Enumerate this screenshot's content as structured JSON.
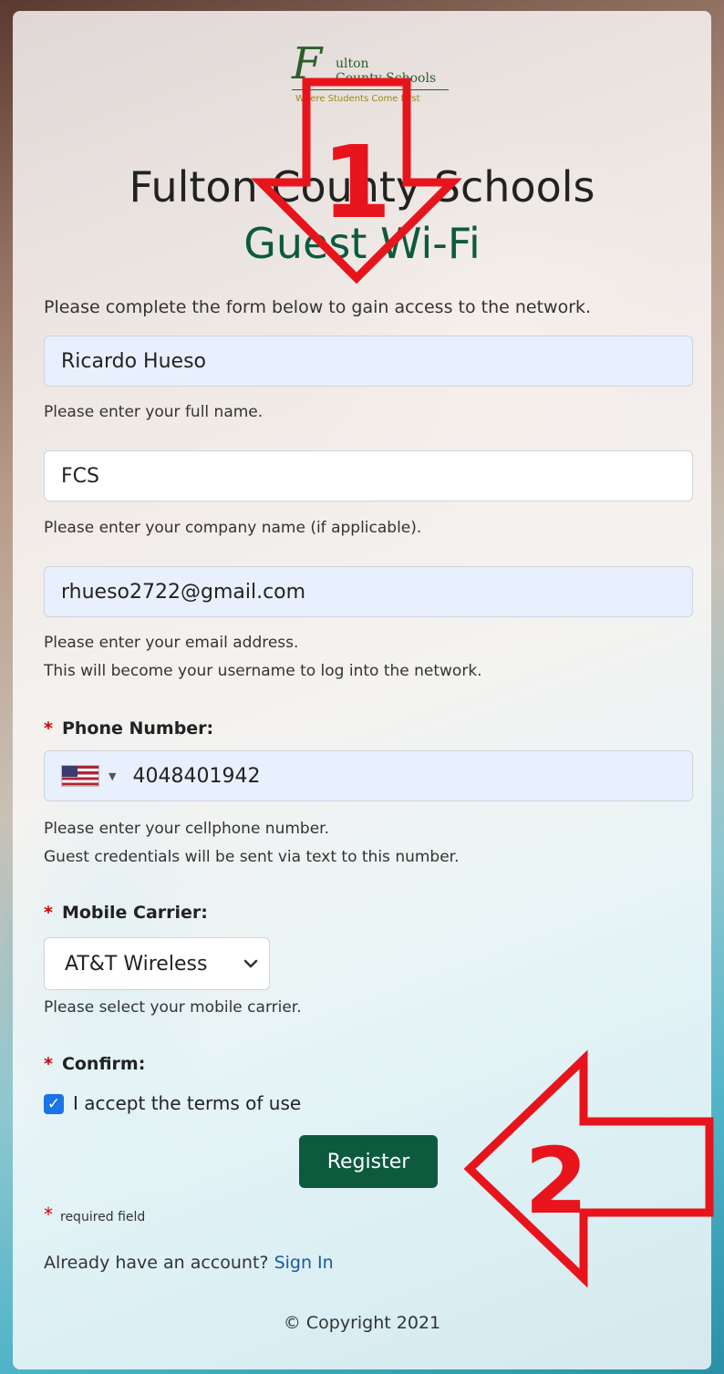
{
  "logo": {
    "script_letter": "F",
    "line1": "ulton",
    "line2": "County Schools",
    "tagline": "Where Students Come First"
  },
  "header": {
    "title": "Fulton County Schools",
    "subtitle": "Guest Wi-Fi"
  },
  "intro": "Please complete the form below to gain access to the network.",
  "form": {
    "full_name": {
      "value": "Ricardo Hueso",
      "help": "Please enter your full name."
    },
    "company": {
      "value": "FCS",
      "help": "Please enter your company name (if applicable)."
    },
    "email": {
      "value": "rhueso2722@gmail.com",
      "help_line1": "Please enter your email address.",
      "help_line2": "This will become your username to log into the network."
    },
    "phone": {
      "label": "Phone Number:",
      "value": "4048401942",
      "country_icon": "us-flag-icon",
      "help_line1": "Please enter your cellphone number.",
      "help_line2": "Guest credentials will be sent via text to this number."
    },
    "carrier": {
      "label": "Mobile Carrier:",
      "selected": "AT&T Wireless",
      "help": "Please select your mobile carrier."
    },
    "confirm": {
      "label": "Confirm:",
      "checkbox_label": "I accept the terms of use",
      "checked": true
    },
    "register_label": "Register",
    "required_asterisk": "*",
    "required_note": "required field"
  },
  "signin": {
    "prompt": "Already have an account?",
    "link": "Sign In"
  },
  "footer": {
    "copyright": "© Copyright 2021"
  },
  "annotations": [
    {
      "label": "1",
      "direction": "down",
      "color": "#e8141c"
    },
    {
      "label": "2",
      "direction": "left",
      "color": "#e8141c"
    }
  ],
  "colors": {
    "brand_green": "#0d5a3e",
    "checkbox_blue": "#1a73e8",
    "autofill_bg": "#e8f0fe",
    "required_red": "#d10000",
    "annotation_red": "#e8141c"
  }
}
